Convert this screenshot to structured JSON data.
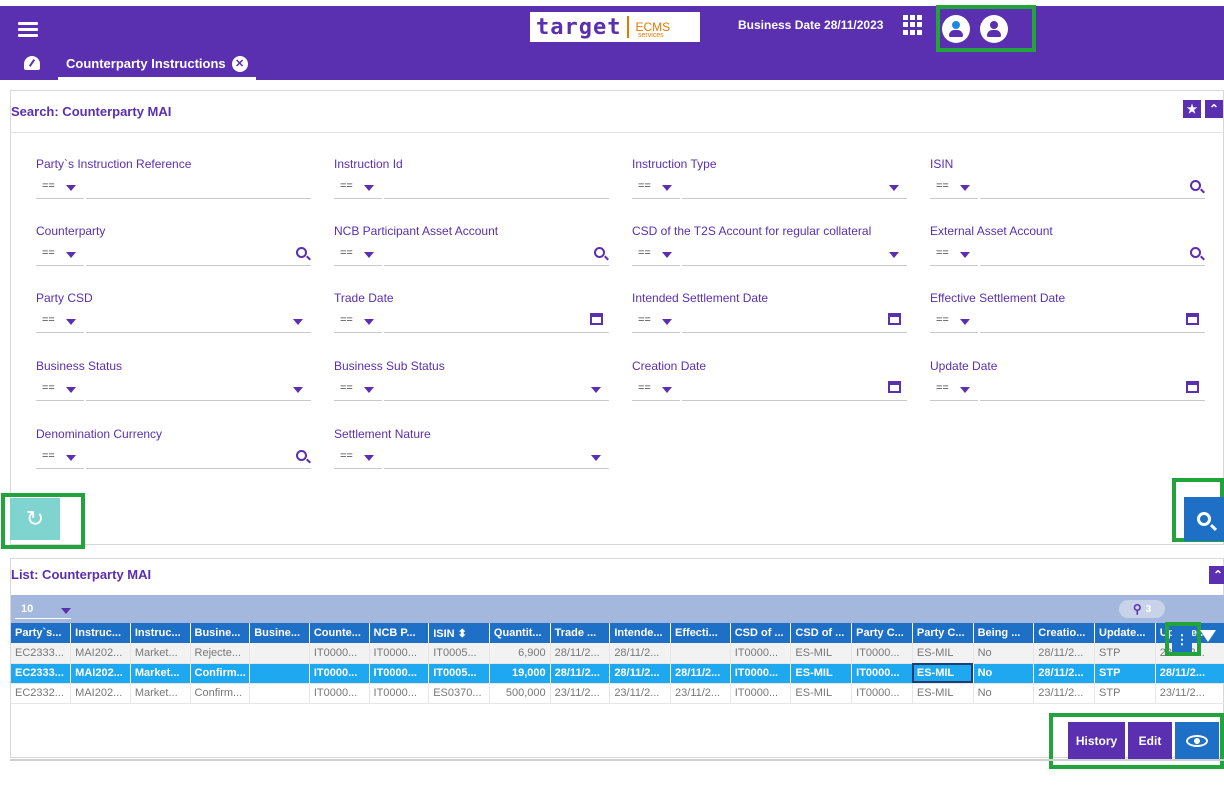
{
  "header": {
    "logo_word": "target",
    "logo_services": "services",
    "logo_ecms": "ECMS",
    "business_date": "Business Date 28/11/2023"
  },
  "tab": {
    "label": "Counterparty Instructions"
  },
  "search": {
    "title": "Search: Counterparty MAI",
    "op_default": "==",
    "fields": [
      {
        "label": "Party`s Instruction Reference"
      },
      {
        "label": "Instruction Id"
      },
      {
        "label": "Instruction Type"
      },
      {
        "label": "ISIN"
      },
      {
        "label": "Counterparty"
      },
      {
        "label": "NCB Participant Asset Account"
      },
      {
        "label": "CSD of the T2S Account for regular collateral"
      },
      {
        "label": "External Asset Account"
      },
      {
        "label": "Party CSD"
      },
      {
        "label": "Trade Date"
      },
      {
        "label": "Intended Settlement Date"
      },
      {
        "label": "Effective Settlement Date"
      },
      {
        "label": "Business Status"
      },
      {
        "label": "Business Sub Status"
      },
      {
        "label": "Creation Date"
      },
      {
        "label": "Update Date"
      },
      {
        "label": "Denomination Currency"
      },
      {
        "label": "Settlement Nature"
      }
    ]
  },
  "list": {
    "title": "List: Counterparty MAI",
    "page_size": "10",
    "search_count": "3",
    "columns": [
      "Party`s...",
      "Instruc...",
      "Instruc...",
      "Busine...",
      "Busine...",
      "Counte...",
      "NCB P...",
      "ISIN ⬍",
      "Quantit...",
      "Trade ...",
      "Intende...",
      "Effecti...",
      "CSD of ...",
      "CSD of ...",
      "Party C...",
      "Party C...",
      "Being ...",
      "Creatio...",
      "Update...",
      "Update..."
    ],
    "rows": [
      [
        "EC2333...",
        "MAI202...",
        "Market...",
        "Rejecte...",
        "",
        "IT0000...",
        "IT0000...",
        "IT0005...",
        "6,900",
        "28/11/2...",
        "28/11/2...",
        "",
        "IT0000...",
        "ES-MIL",
        "IT0000...",
        "ES-MIL",
        "No",
        "28/11/2...",
        "STP",
        "28/11/2..."
      ],
      [
        "EC2333...",
        "MAI202...",
        "Market...",
        "Confirm...",
        "",
        "IT0000...",
        "IT0000...",
        "IT0005...",
        "19,000",
        "28/11/2...",
        "28/11/2...",
        "28/11/2...",
        "IT0000...",
        "ES-MIL",
        "IT0000...",
        "ES-MIL",
        "No",
        "28/11/2...",
        "STP",
        "28/11/2..."
      ],
      [
        "EC2332...",
        "MAI202...",
        "Market...",
        "Confirm...",
        "",
        "IT0000...",
        "IT0000...",
        "ES0370...",
        "500,000",
        "23/11/2...",
        "23/11/2...",
        "23/11/2...",
        "IT0000...",
        "ES-MIL",
        "IT0000...",
        "ES-MIL",
        "No",
        "23/11/2...",
        "STP",
        "23/11/2..."
      ]
    ],
    "actions": {
      "history": "History",
      "edit": "Edit"
    }
  },
  "icons": [
    "menu-icon",
    "apps-grid-icon",
    "user-icon",
    "dashboard-icon",
    "close-icon",
    "favorite-star-icon",
    "collapse-icon",
    "search-icon",
    "calendar-icon",
    "reset-icon",
    "more-vertical-icon",
    "filter-icon",
    "view-eye-icon"
  ]
}
